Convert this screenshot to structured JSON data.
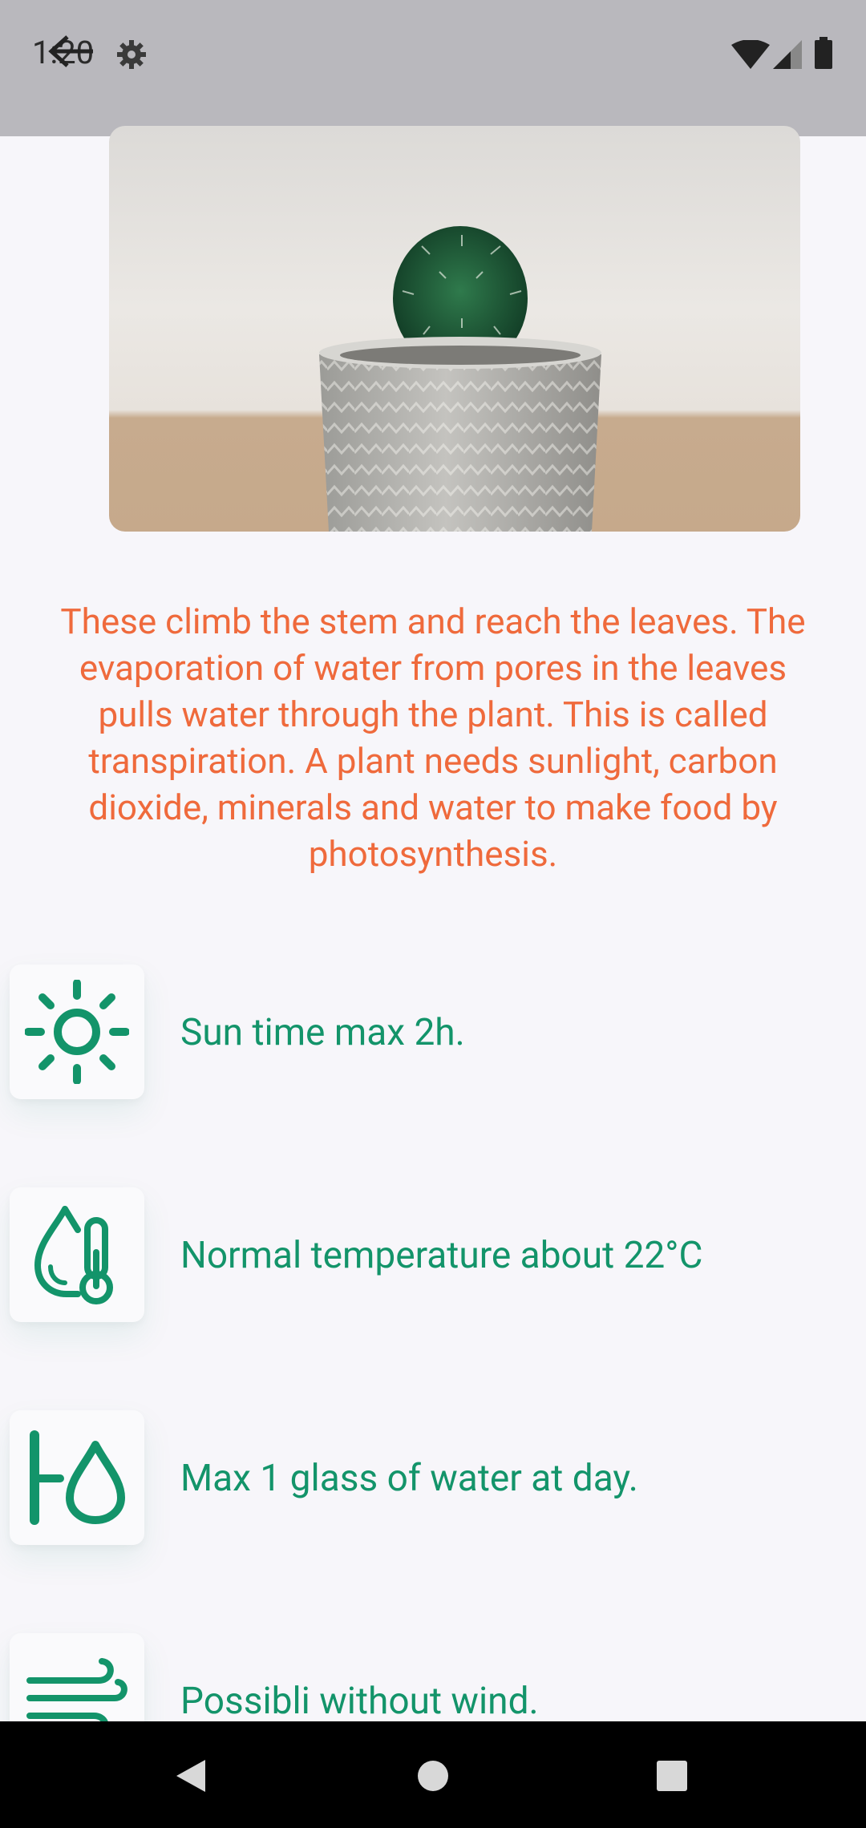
{
  "status_bar": {
    "time": "1:20",
    "icons": [
      "back-arrow-icon",
      "gear-icon",
      "wifi-icon",
      "signal-icon",
      "battery-icon"
    ]
  },
  "description": "These climb the stem and reach the leaves. The evaporation of water from pores in the leaves pulls water through the plant. This is called transpiration. A plant needs sunlight, carbon dioxide, minerals and water to make food by photosynthesis.",
  "care_items": [
    {
      "icon": "sun-icon",
      "text": "Sun time max 2h."
    },
    {
      "icon": "thermometer-drop-icon",
      "text": "Normal temperature about 22°C"
    },
    {
      "icon": "water-tap-drop-icon",
      "text": "Max 1 glass of water at day."
    },
    {
      "icon": "wind-icon",
      "text": "Possibli without wind."
    }
  ],
  "colors": {
    "accent_orange": "#EF6A3C",
    "accent_green": "#13946A",
    "background": "#F7F6FA",
    "status_bar": "#B9B8BD"
  },
  "nav_bar": {
    "icons": [
      "nav-back-icon",
      "nav-home-icon",
      "nav-recents-icon"
    ]
  }
}
